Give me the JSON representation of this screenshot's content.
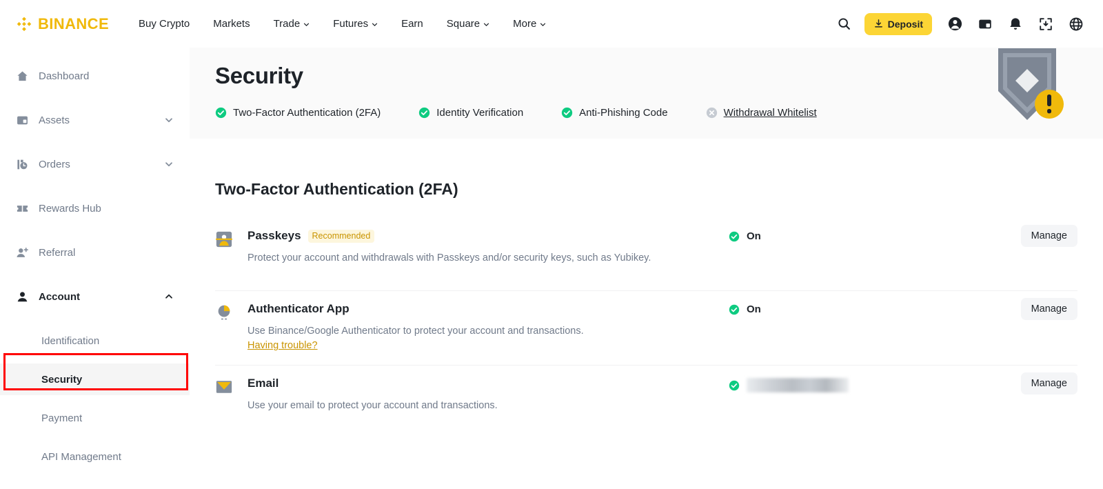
{
  "header": {
    "brand": "BINANCE",
    "brand_color": "#F0B90B",
    "nav": [
      {
        "label": "Buy Crypto",
        "icon": "",
        "caret": false
      },
      {
        "label": "Markets",
        "icon": "",
        "caret": false
      },
      {
        "label": "Trade",
        "icon": "chevron-down-icon",
        "caret": true
      },
      {
        "label": "Futures",
        "icon": "chevron-down-icon",
        "caret": true
      },
      {
        "label": "Earn",
        "icon": "",
        "caret": false
      },
      {
        "label": "Square",
        "icon": "chevron-down-icon",
        "caret": true
      },
      {
        "label": "More",
        "icon": "chevron-down-icon",
        "caret": true
      }
    ],
    "search_icon": "search-icon",
    "deposit_label": "Deposit",
    "deposit_icon": "download-icon",
    "deposit_bg": "#FCD535",
    "right_icons": [
      "profile-icon",
      "wallet-icon",
      "notification-bell-icon",
      "inbox-download-icon",
      "globe-language-icon"
    ]
  },
  "sidebar": {
    "items": [
      {
        "label": "Dashboard",
        "icon": "home-icon",
        "caret": null,
        "active": false
      },
      {
        "label": "Assets",
        "icon": "wallet-icon",
        "caret": "down",
        "active": false
      },
      {
        "label": "Orders",
        "icon": "orders-clock-icon",
        "caret": "down",
        "active": false
      },
      {
        "label": "Rewards Hub",
        "icon": "ticket-icon",
        "caret": null,
        "active": false
      },
      {
        "label": "Referral",
        "icon": "user-plus-icon",
        "caret": null,
        "active": false
      },
      {
        "label": "Account",
        "icon": "person-icon",
        "caret": "up",
        "active": true
      }
    ],
    "sub_items": [
      {
        "label": "Identification",
        "selected": false
      },
      {
        "label": "Security",
        "selected": true
      },
      {
        "label": "Payment",
        "selected": false
      },
      {
        "label": "API Management",
        "selected": false
      }
    ],
    "highlight_color": "#ff0000"
  },
  "page": {
    "title": "Security",
    "status_chips": [
      {
        "label": "Two-Factor Authentication (2FA)",
        "state": "on",
        "icon": "check-circle-icon"
      },
      {
        "label": "Identity Verification",
        "state": "on",
        "icon": "check-circle-icon"
      },
      {
        "label": "Anti-Phishing Code",
        "state": "on",
        "icon": "check-circle-icon"
      },
      {
        "label": "Withdrawal Whitelist",
        "state": "off",
        "icon": "x-circle-icon"
      }
    ],
    "shield_icon": "shield-warning-icon",
    "on_color": "#0ECB81",
    "off_color": "#b7bdc6"
  },
  "section": {
    "title": "Two-Factor Authentication (2FA)",
    "rows": [
      {
        "name": "Passkeys",
        "icon": "passkey-badge-icon",
        "badge": "Recommended",
        "desc": "Protect your account and withdrawals with Passkeys and/or security keys, such as Yubikey.",
        "link": "",
        "status_text": "On",
        "status_type": "on",
        "action": "Manage"
      },
      {
        "name": "Authenticator App",
        "icon": "authenticator-pie-icon",
        "badge": "",
        "desc": "Use Binance/Google Authenticator to protect your account and transactions.",
        "link": "Having trouble?",
        "status_text": "On",
        "status_type": "on",
        "action": "Manage"
      },
      {
        "name": "Email",
        "icon": "email-envelope-icon",
        "badge": "",
        "desc": "Use your email to protect your account and transactions.",
        "link": "",
        "status_text": "",
        "status_type": "redacted",
        "action": "Manage"
      }
    ]
  }
}
